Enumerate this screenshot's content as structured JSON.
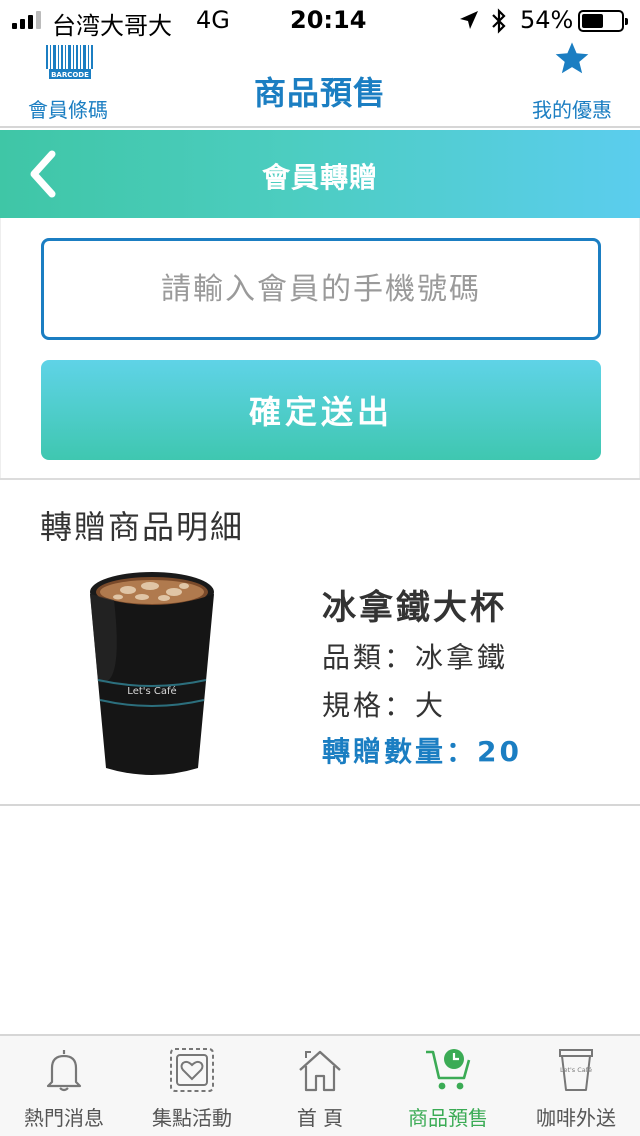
{
  "status_bar": {
    "carrier": "台湾大哥大",
    "network": "4G",
    "time": "20:14",
    "battery_percent": "54%",
    "battery_level": 0.54
  },
  "header": {
    "left_label": "會員條碼",
    "barcode_text": "BARCODE",
    "title": "商品預售",
    "right_label": "我的優惠"
  },
  "sub_header": {
    "title": "會員轉贈"
  },
  "form": {
    "phone_placeholder": "請輸入會員的手機號碼",
    "phone_value": "",
    "submit_label": "確定送出"
  },
  "detail": {
    "section_title": "轉贈商品明細",
    "cup_brand": "Let's Café",
    "item_name": "冰拿鐵大杯",
    "category_row": "品類：冰拿鐵",
    "spec_row": "規格：大",
    "quantity_row": "轉贈數量：20"
  },
  "tabs": [
    {
      "label": "熱門消息",
      "icon": "bell-icon",
      "active": false
    },
    {
      "label": "集點活動",
      "icon": "stamp-card-icon",
      "active": false
    },
    {
      "label": "首 頁",
      "icon": "home-icon",
      "active": false
    },
    {
      "label": "商品預售",
      "icon": "cart-clock-icon",
      "active": true
    },
    {
      "label": "咖啡外送",
      "icon": "coffee-cup-icon",
      "active": false
    }
  ],
  "colors": {
    "brand_blue": "#1b7ec2",
    "gradient_start": "#3fc6a6",
    "gradient_end": "#5bcdee",
    "active_tab_green": "#3bab55"
  }
}
